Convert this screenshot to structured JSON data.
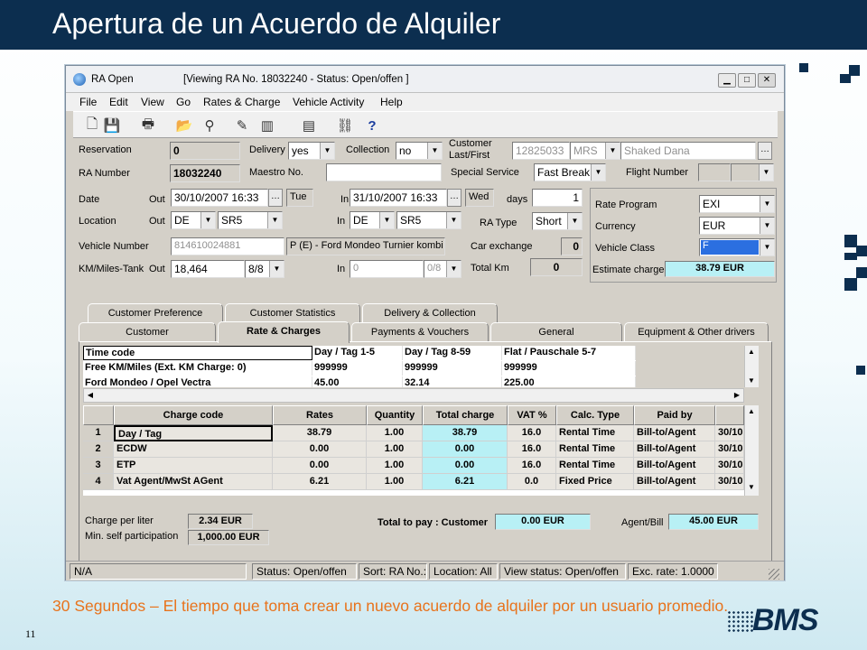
{
  "slide": {
    "title": "Apertura de un Acuerdo de Alquiler",
    "caption": "30 Segundos – El tiempo que toma crear un nuevo acuerdo de alquiler por un usuario promedio.",
    "page_number": "11",
    "logo_text": "BMS",
    "colors": {
      "header": "#0c2e4f",
      "caption": "#e8731c",
      "highlight": "#b8f0f5"
    }
  },
  "window": {
    "app_name": "RA Open",
    "caption": "[Viewing  RA  No. 18032240  - Status: Open/offen ]",
    "controls": {
      "minimize": "▁",
      "maximize": "□",
      "close": "✕"
    }
  },
  "menu": [
    "File",
    "Edit",
    "View",
    "Go",
    "Rates & Charge",
    "Vehicle Activity",
    "Help"
  ],
  "toolbar": [
    "new-icon",
    "save-icon",
    "print-icon",
    "open-folder-icon",
    "binoculars-icon",
    "edit-icon",
    "chart-icon",
    "document-icon",
    "link-icon",
    "help-icon"
  ],
  "form": {
    "reservation_label": "Reservation",
    "reservation_value": "0",
    "delivery_label": "Delivery",
    "delivery_value": "yes",
    "collection_label": "Collection",
    "collection_value": "no",
    "customer_label": "Customer Last/First",
    "customer_id": "12825033",
    "customer_type": "MRS",
    "customer_name": "Shaked Dana",
    "ra_number_label": "RA Number",
    "ra_number_value": "18032240",
    "maestro_label": "Maestro No.",
    "maestro_value": "",
    "special_service_label": "Special Service",
    "special_service_value": "Fast Break",
    "flight_label": "Flight Number",
    "date_label": "Date",
    "out_label": "Out",
    "in_label": "In",
    "date_out": "30/10/2007  16:33",
    "date_out_day": "Tue",
    "date_in": "31/10/2007  16:33",
    "date_in_day": "Wed",
    "days_label": "days",
    "days_value": "1",
    "location_label": "Location",
    "loc_out_country": "DE",
    "loc_out_station": "SR5",
    "loc_in_country": "DE",
    "loc_in_station": "SR5",
    "ra_type_label": "RA Type",
    "ra_type_value": "Short",
    "vehicle_number_label": "Vehicle Number",
    "vehicle_number_value": "814610024881",
    "vehicle_desc": "P (E) - Ford Mondeo Turnier kombi",
    "car_exchange_label": "Car exchange",
    "car_exchange_value": "0",
    "km_label": "KM/Miles-Tank",
    "km_out": "18,464",
    "tank_out": "8/8",
    "km_in": "0",
    "tank_in": "0/8",
    "total_km_label": "Total Km",
    "total_km_value": "0"
  },
  "rate_panel": {
    "rate_program_label": "Rate Program",
    "rate_program_value": "EXI",
    "currency_label": "Currency",
    "currency_value": "EUR",
    "vehicle_class_label": "Vehicle Class",
    "vehicle_class_value": "F",
    "estimate_label": "Estimate charge",
    "estimate_value": "38.79 EUR"
  },
  "tabs_back": [
    "Customer Preference",
    "Customer Statistics",
    "Delivery & Collection"
  ],
  "tabs_front": [
    "Customer",
    "Rate & Charges",
    "Payments & Vouchers",
    "General",
    "Equipment & Other drivers"
  ],
  "rate_grid": {
    "headers": [
      "Time code",
      "Day / Tag 1-5",
      "Day / Tag 8-59",
      "Flat / Pauschale 5-7"
    ],
    "rows": [
      [
        "Free KM/Miles (Ext. KM Charge: 0)",
        "999999",
        "999999",
        "999999"
      ],
      [
        "Ford Mondeo / Opel Vectra",
        "45.00",
        "32.14",
        "225.00"
      ]
    ]
  },
  "charge_grid": {
    "headers": [
      "",
      "Charge code",
      "Rates",
      "Quantity",
      "Total charge",
      "VAT %",
      "Calc. Type",
      "Paid by",
      ""
    ],
    "rows": [
      [
        "1",
        "Day / Tag",
        "38.79",
        "1.00",
        "38.79",
        "16.0",
        "Rental Time",
        "Bill-to/Agent",
        "30/10"
      ],
      [
        "2",
        "ECDW",
        "0.00",
        "1.00",
        "0.00",
        "16.0",
        "Rental Time",
        "Bill-to/Agent",
        "30/10"
      ],
      [
        "3",
        "ETP",
        "0.00",
        "1.00",
        "0.00",
        "16.0",
        "Rental Time",
        "Bill-to/Agent",
        "30/10"
      ],
      [
        "4",
        "Vat Agent/MwSt AGent",
        "6.21",
        "1.00",
        "6.21",
        "0.0",
        "Fixed Price",
        "Bill-to/Agent",
        "30/10"
      ]
    ]
  },
  "footer_fields": {
    "charge_per_liter_label": "Charge per liter",
    "charge_per_liter_value": "2.34 EUR",
    "min_self_label": "Min. self participation",
    "min_self_value": "1,000.00 EUR",
    "total_to_pay_label": "Total to pay : Customer",
    "total_customer_value": "0.00 EUR",
    "agent_bill_label": "Agent/Bill",
    "agent_bill_value": "45.00 EUR"
  },
  "statusbar": [
    "N/A",
    "Status: Open/offen",
    "Sort: RA No.:",
    "Location: All",
    "View status: Open/offen",
    "Exc. rate: 1.0000"
  ]
}
